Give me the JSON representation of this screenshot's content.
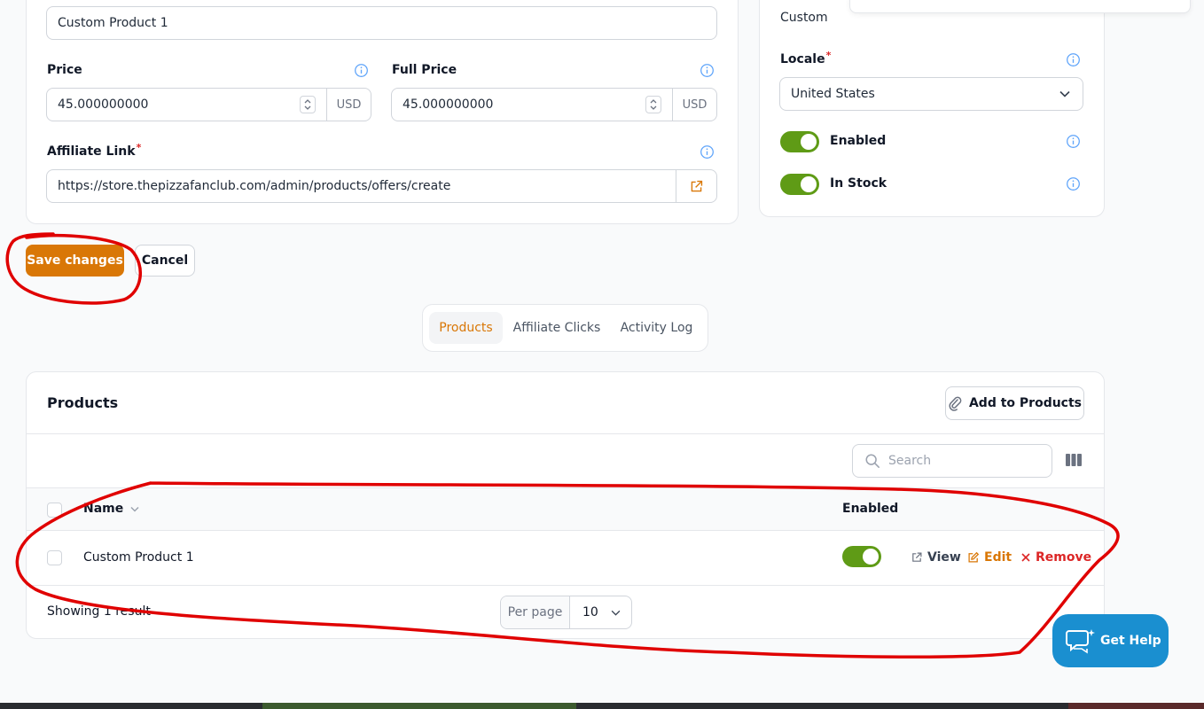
{
  "form": {
    "name_value": "Custom Product 1",
    "price": {
      "label": "Price",
      "value": "45.000000000",
      "currency": "USD"
    },
    "full_price": {
      "label": "Full Price",
      "value": "45.000000000",
      "currency": "USD"
    },
    "affiliate_link": {
      "label": "Affiliate Link",
      "required_mark": "*",
      "value": "https://store.thepizzafanclub.com/admin/products/offers/create"
    }
  },
  "side_panel": {
    "type_value": "Custom",
    "locale": {
      "label": "Locale",
      "required_mark": "*",
      "value": "United States"
    },
    "enabled_label": "Enabled",
    "in_stock_label": "In Stock"
  },
  "actions": {
    "save_label": "Save changes",
    "cancel_label": "Cancel"
  },
  "tabs": [
    {
      "label": "Products",
      "active": true
    },
    {
      "label": "Affiliate Clicks",
      "active": false
    },
    {
      "label": "Activity Log",
      "active": false
    }
  ],
  "products_table": {
    "title": "Products",
    "add_button_label": "Add to Products",
    "search_placeholder": "Search",
    "columns": {
      "name": "Name",
      "enabled": "Enabled"
    },
    "rows": [
      {
        "name": "Custom Product 1",
        "enabled": true,
        "view_label": "View",
        "edit_label": "Edit",
        "remove_label": "Remove"
      }
    ],
    "footer": {
      "showing": "Showing 1 result",
      "per_page_label": "Per page",
      "per_page_value": "10"
    }
  },
  "help": {
    "label": "Get Help"
  },
  "colors": {
    "primary": "#d97706",
    "toggle_on": "#5f9b16",
    "danger": "#dc2626",
    "help": "#1a8fd0",
    "annotation": "#e00000"
  }
}
